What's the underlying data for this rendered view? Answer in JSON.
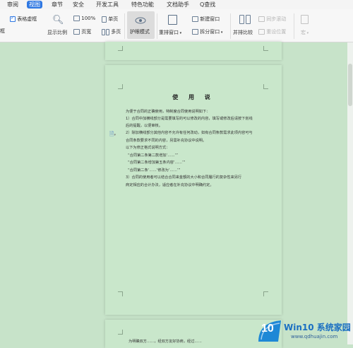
{
  "menu": {
    "review": "审阅",
    "view": "视图",
    "section": "章节",
    "security": "安全",
    "dev_tools": "开发工具",
    "features": "特色功能",
    "doc_helper": "文档助手",
    "search": "Q查找"
  },
  "ribbon": {
    "table_gridlines": "表格虚框",
    "left_cut_text": "框",
    "show_ratio": "显示比例",
    "zoom_100": "100%",
    "page_width": "页宽",
    "single_page": "单页",
    "multi_page": "多页",
    "eye_protection": "护眼模式",
    "rearrange_windows": "重排窗口",
    "new_window": "新建窗口",
    "split_window": "拆分窗口",
    "side_by_side": "并排比较",
    "sync_scroll": "同步滚动",
    "reset_position": "重设位置",
    "right_cut_text": "宏"
  },
  "document": {
    "title": "使 用 说",
    "lines": [
      "为便于合同的正确使用，特制度合同使用说明如下：",
      "1）合同中加横线部分是需要填写的可以修改的内容，填写或修改后请按下划线",
      "后的提醒，以便审核。",
      "2）除加横线部分其他内容不允许有任何改动，如有合同条款需求此项内容可与",
      "合同条款要求不同的内容，另需补充协议中说明。",
      "以下为修正格式说明方式：",
      "“合同第二条第二款增加‘……’”",
      "“合同第二条增加第五条内容‘……’”",
      "“合同第二条‘……’修改为‘……’”",
      "3）合同的使用者可以结合合同来金额的大小和合同履行的复杂性来另行",
      "商定相应的合计办法，适应者在补充协议中明确约定。"
    ],
    "bottom_line": "为明确双方……，经双方友好协商，经过……"
  },
  "watermark": {
    "brand": "Win10 系统家园",
    "url": "www.qdhuajin.com",
    "logo_number": "10"
  },
  "colors": {
    "accent": "#2f78e2",
    "doc_background": "#c7e3c9",
    "page_background": "#c9e7cb"
  }
}
